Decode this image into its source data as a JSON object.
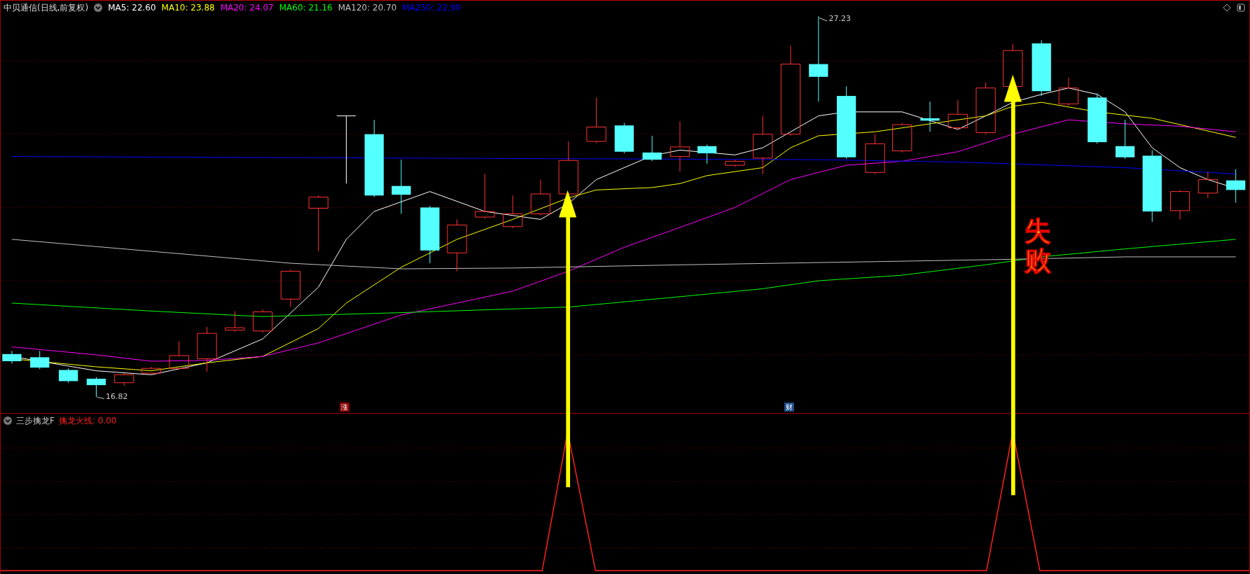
{
  "window": {
    "title": "中贝通信(日线,前复权)"
  },
  "ma_readouts": [
    {
      "label": "MA5: 22.60",
      "color": "#ffffff"
    },
    {
      "label": "MA10: 23.88",
      "color": "#ffff00"
    },
    {
      "label": "MA20: 24.07",
      "color": "#ff00ff"
    },
    {
      "label": "MA60: 21.16",
      "color": "#00ff00"
    },
    {
      "label": "MA120: 20.70",
      "color": "#c0c0c0"
    },
    {
      "label": "MA250: 22.90",
      "color": "#0000ff"
    }
  ],
  "price_labels": {
    "high": "27.23",
    "low": "16.82"
  },
  "event_badges": [
    {
      "text": "涨",
      "kind": "rise"
    },
    {
      "text": "财",
      "kind": "finance"
    }
  ],
  "annotation": "失败",
  "indicator": {
    "name": "三步擒龙F",
    "readout": "擒龙火线: 0.00"
  }
}
